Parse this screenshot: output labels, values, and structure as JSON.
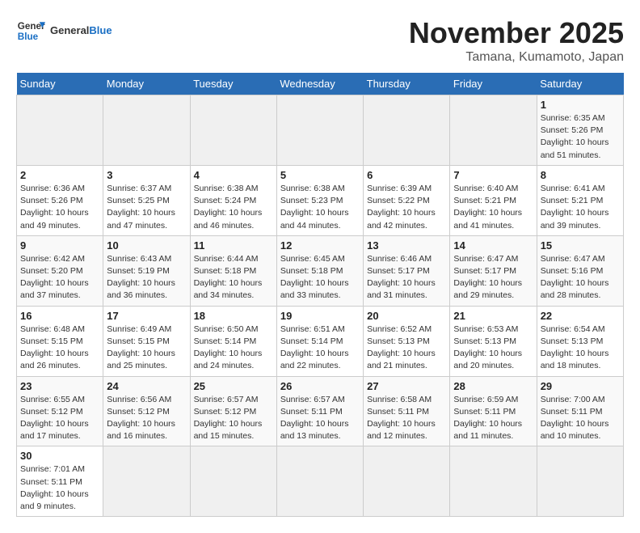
{
  "header": {
    "logo_general": "General",
    "logo_blue": "Blue",
    "month_title": "November 2025",
    "location": "Tamana, Kumamoto, Japan"
  },
  "weekdays": [
    "Sunday",
    "Monday",
    "Tuesday",
    "Wednesday",
    "Thursday",
    "Friday",
    "Saturday"
  ],
  "weeks": [
    [
      {
        "day": "",
        "info": ""
      },
      {
        "day": "",
        "info": ""
      },
      {
        "day": "",
        "info": ""
      },
      {
        "day": "",
        "info": ""
      },
      {
        "day": "",
        "info": ""
      },
      {
        "day": "",
        "info": ""
      },
      {
        "day": "1",
        "info": "Sunrise: 6:35 AM\nSunset: 5:26 PM\nDaylight: 10 hours\nand 51 minutes."
      }
    ],
    [
      {
        "day": "2",
        "info": "Sunrise: 6:36 AM\nSunset: 5:26 PM\nDaylight: 10 hours\nand 49 minutes."
      },
      {
        "day": "3",
        "info": "Sunrise: 6:37 AM\nSunset: 5:25 PM\nDaylight: 10 hours\nand 47 minutes."
      },
      {
        "day": "4",
        "info": "Sunrise: 6:38 AM\nSunset: 5:24 PM\nDaylight: 10 hours\nand 46 minutes."
      },
      {
        "day": "5",
        "info": "Sunrise: 6:38 AM\nSunset: 5:23 PM\nDaylight: 10 hours\nand 44 minutes."
      },
      {
        "day": "6",
        "info": "Sunrise: 6:39 AM\nSunset: 5:22 PM\nDaylight: 10 hours\nand 42 minutes."
      },
      {
        "day": "7",
        "info": "Sunrise: 6:40 AM\nSunset: 5:21 PM\nDaylight: 10 hours\nand 41 minutes."
      },
      {
        "day": "8",
        "info": "Sunrise: 6:41 AM\nSunset: 5:21 PM\nDaylight: 10 hours\nand 39 minutes."
      }
    ],
    [
      {
        "day": "9",
        "info": "Sunrise: 6:42 AM\nSunset: 5:20 PM\nDaylight: 10 hours\nand 37 minutes."
      },
      {
        "day": "10",
        "info": "Sunrise: 6:43 AM\nSunset: 5:19 PM\nDaylight: 10 hours\nand 36 minutes."
      },
      {
        "day": "11",
        "info": "Sunrise: 6:44 AM\nSunset: 5:18 PM\nDaylight: 10 hours\nand 34 minutes."
      },
      {
        "day": "12",
        "info": "Sunrise: 6:45 AM\nSunset: 5:18 PM\nDaylight: 10 hours\nand 33 minutes."
      },
      {
        "day": "13",
        "info": "Sunrise: 6:46 AM\nSunset: 5:17 PM\nDaylight: 10 hours\nand 31 minutes."
      },
      {
        "day": "14",
        "info": "Sunrise: 6:47 AM\nSunset: 5:17 PM\nDaylight: 10 hours\nand 29 minutes."
      },
      {
        "day": "15",
        "info": "Sunrise: 6:47 AM\nSunset: 5:16 PM\nDaylight: 10 hours\nand 28 minutes."
      }
    ],
    [
      {
        "day": "16",
        "info": "Sunrise: 6:48 AM\nSunset: 5:15 PM\nDaylight: 10 hours\nand 26 minutes."
      },
      {
        "day": "17",
        "info": "Sunrise: 6:49 AM\nSunset: 5:15 PM\nDaylight: 10 hours\nand 25 minutes."
      },
      {
        "day": "18",
        "info": "Sunrise: 6:50 AM\nSunset: 5:14 PM\nDaylight: 10 hours\nand 24 minutes."
      },
      {
        "day": "19",
        "info": "Sunrise: 6:51 AM\nSunset: 5:14 PM\nDaylight: 10 hours\nand 22 minutes."
      },
      {
        "day": "20",
        "info": "Sunrise: 6:52 AM\nSunset: 5:13 PM\nDaylight: 10 hours\nand 21 minutes."
      },
      {
        "day": "21",
        "info": "Sunrise: 6:53 AM\nSunset: 5:13 PM\nDaylight: 10 hours\nand 20 minutes."
      },
      {
        "day": "22",
        "info": "Sunrise: 6:54 AM\nSunset: 5:13 PM\nDaylight: 10 hours\nand 18 minutes."
      }
    ],
    [
      {
        "day": "23",
        "info": "Sunrise: 6:55 AM\nSunset: 5:12 PM\nDaylight: 10 hours\nand 17 minutes."
      },
      {
        "day": "24",
        "info": "Sunrise: 6:56 AM\nSunset: 5:12 PM\nDaylight: 10 hours\nand 16 minutes."
      },
      {
        "day": "25",
        "info": "Sunrise: 6:57 AM\nSunset: 5:12 PM\nDaylight: 10 hours\nand 15 minutes."
      },
      {
        "day": "26",
        "info": "Sunrise: 6:57 AM\nSunset: 5:11 PM\nDaylight: 10 hours\nand 13 minutes."
      },
      {
        "day": "27",
        "info": "Sunrise: 6:58 AM\nSunset: 5:11 PM\nDaylight: 10 hours\nand 12 minutes."
      },
      {
        "day": "28",
        "info": "Sunrise: 6:59 AM\nSunset: 5:11 PM\nDaylight: 10 hours\nand 11 minutes."
      },
      {
        "day": "29",
        "info": "Sunrise: 7:00 AM\nSunset: 5:11 PM\nDaylight: 10 hours\nand 10 minutes."
      }
    ],
    [
      {
        "day": "30",
        "info": "Sunrise: 7:01 AM\nSunset: 5:11 PM\nDaylight: 10 hours\nand 9 minutes."
      },
      {
        "day": "",
        "info": ""
      },
      {
        "day": "",
        "info": ""
      },
      {
        "day": "",
        "info": ""
      },
      {
        "day": "",
        "info": ""
      },
      {
        "day": "",
        "info": ""
      },
      {
        "day": "",
        "info": ""
      }
    ]
  ]
}
